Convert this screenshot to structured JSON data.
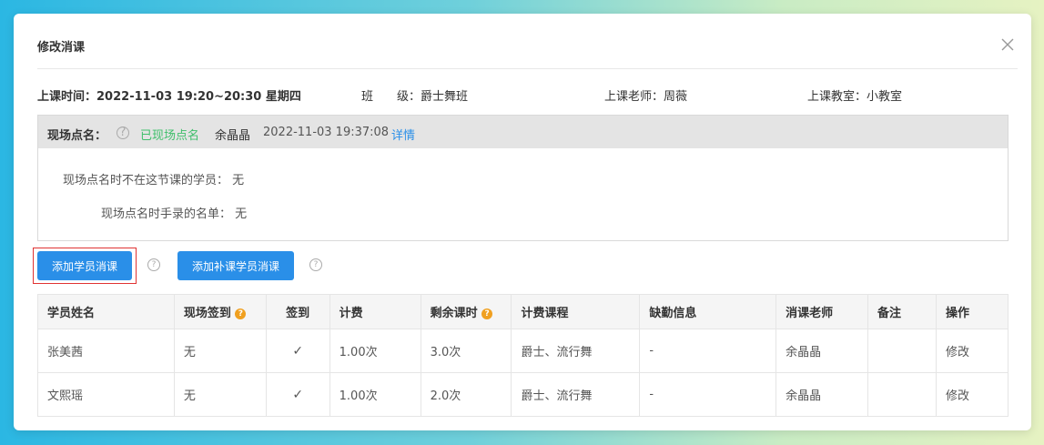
{
  "modal": {
    "title": "修改消课"
  },
  "lesson_info": {
    "time_label": "上课时间：",
    "time_value": "2022-11-03 19:20~20:30 星期四",
    "class_label": "班　　级：",
    "class_value": "爵士舞班",
    "teacher_label": "上课老师：",
    "teacher_value": "周薇",
    "room_label": "上课教室：",
    "room_value": "小教室"
  },
  "rollcall": {
    "label": "现场点名：",
    "help_icon": "?",
    "status": "已现场点名",
    "operator": "余晶晶",
    "timestamp": "2022-11-03 19:37:08",
    "detail_link": "详情",
    "absent_label": "现场点名时不在这节课的学员：",
    "absent_value": "无",
    "manual_label": "现场点名时手录的名单：",
    "manual_value": "无"
  },
  "actions": {
    "add_student_label": "添加学员消课",
    "add_makeup_label": "添加补课学员消课"
  },
  "table": {
    "headers": [
      "学员姓名",
      "现场签到",
      "签到",
      "计费",
      "剩余课时",
      "计费课程",
      "缺勤信息",
      "消课老师",
      "备注",
      "操作"
    ],
    "rows": [
      [
        "张美茜",
        "无",
        "✓",
        "1.00次",
        "3.0次",
        "爵士、流行舞",
        "-",
        "余晶晶",
        "",
        "修改"
      ],
      [
        "文熙瑶",
        "无",
        "✓",
        "1.00次",
        "2.0次",
        "爵士、流行舞",
        "-",
        "余晶晶",
        "",
        "修改"
      ]
    ]
  },
  "colors": {
    "primary": "#2a8fe8",
    "success": "#3fbf6b",
    "warning": "#f0a020",
    "highlight_outline": "#e03333"
  }
}
